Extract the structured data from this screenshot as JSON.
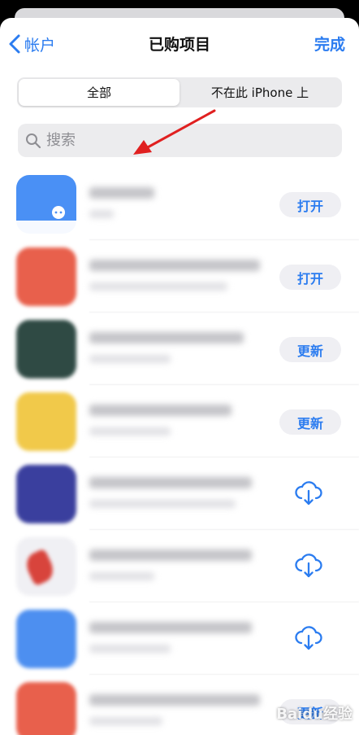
{
  "nav": {
    "back_label": "帐户",
    "title": "已购项目",
    "done_label": "完成"
  },
  "segment": {
    "options": [
      "全部",
      "不在此 iPhone 上"
    ],
    "selected": "全部"
  },
  "search": {
    "placeholder": "搜索"
  },
  "colors": {
    "accent": "#2b7cf0",
    "arrow": "#e02020"
  },
  "apps": [
    {
      "icon_color": "#4a90f5",
      "action": "打开",
      "action_type": "button"
    },
    {
      "icon_color": "#e8604c",
      "action": "打开",
      "action_type": "button"
    },
    {
      "icon_color": "#2f4a44",
      "action": "更新",
      "action_type": "button"
    },
    {
      "icon_color": "#f1c94a",
      "action": "更新",
      "action_type": "button"
    },
    {
      "icon_color": "#3a3f9e",
      "action": "",
      "action_type": "cloud-download-icon"
    },
    {
      "icon_color": "#f0f0f4",
      "action": "",
      "action_type": "cloud-download-icon"
    },
    {
      "icon_color": "#4d8ff0",
      "action": "",
      "action_type": "cloud-download-icon"
    },
    {
      "icon_color": "#e8604c",
      "action": "更新",
      "action_type": "button"
    }
  ],
  "watermark": "Baidu经验"
}
